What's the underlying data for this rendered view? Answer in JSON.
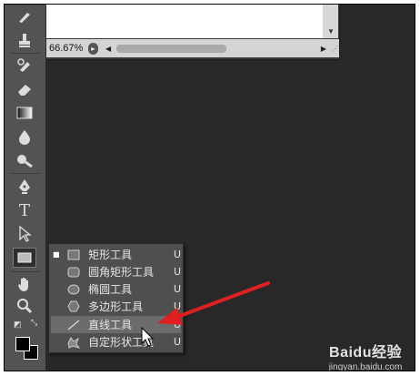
{
  "document": {
    "zoom": "66.67%"
  },
  "toolbar": {
    "tools": [
      {
        "name": "brush-tool",
        "icon": "brush-icon"
      },
      {
        "name": "clone-stamp-tool",
        "icon": "stamp-icon"
      },
      {
        "name": "history-brush-tool",
        "icon": "history-brush-icon"
      },
      {
        "name": "eraser-tool",
        "icon": "eraser-icon"
      },
      {
        "name": "gradient-tool",
        "icon": "gradient-icon"
      },
      {
        "name": "blur-tool",
        "icon": "drop-icon"
      },
      {
        "name": "dodge-tool",
        "icon": "dodge-icon"
      },
      {
        "name": "pen-tool",
        "icon": "pen-icon"
      },
      {
        "name": "type-tool",
        "icon": "type-icon",
        "glyph": "T"
      },
      {
        "name": "path-selection-tool",
        "icon": "arrow-icon"
      },
      {
        "name": "rectangle-tool",
        "icon": "rectangle-icon"
      },
      {
        "name": "hand-tool",
        "icon": "hand-icon"
      },
      {
        "name": "zoom-tool",
        "icon": "magnifier-icon"
      }
    ],
    "foreground_color": "#000000",
    "background_color": "#000000"
  },
  "flyout": {
    "items": [
      {
        "label": "矩形工具",
        "shortcut": "U",
        "icon": "rectangle-shape-icon",
        "selected": true
      },
      {
        "label": "圆角矩形工具",
        "shortcut": "U",
        "icon": "rounded-rectangle-icon",
        "selected": false
      },
      {
        "label": "椭圆工具",
        "shortcut": "U",
        "icon": "ellipse-icon",
        "selected": false
      },
      {
        "label": "多边形工具",
        "shortcut": "U",
        "icon": "polygon-icon",
        "selected": false
      },
      {
        "label": "直线工具",
        "shortcut": "U",
        "icon": "line-icon",
        "selected": false,
        "hovered": true
      },
      {
        "label": "自定形状工具",
        "shortcut": "U",
        "icon": "custom-shape-icon",
        "selected": false
      }
    ]
  },
  "watermark": {
    "logo": "Baidu经验",
    "url": "jingyan.baidu.com"
  },
  "colors": {
    "workspace": "#282828",
    "toolbar": "#535353",
    "annotation_arrow": "#e02020"
  }
}
